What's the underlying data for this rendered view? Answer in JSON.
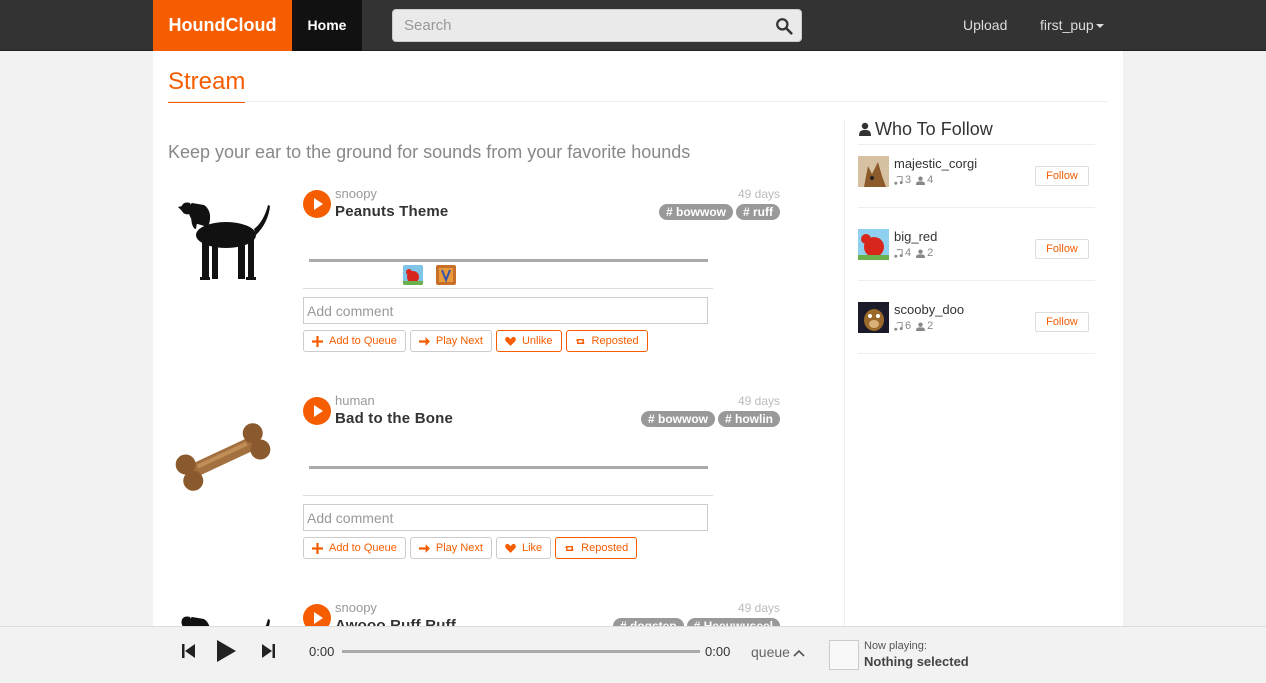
{
  "navbar": {
    "brand": "HoundCloud",
    "home": "Home",
    "search_placeholder": "Search",
    "upload": "Upload",
    "user": "first_pup"
  },
  "page": {
    "title": "Stream",
    "tagline": "Keep your ear to the ground for sounds from your favorite hounds"
  },
  "tracks": [
    {
      "artist": "snoopy",
      "title": "Peanuts Theme",
      "age": "49 days",
      "tags": [
        "# bowwow",
        "# ruff"
      ],
      "comment_placeholder": "Add comment",
      "actions": [
        "Add to Queue",
        "Play Next",
        "Unlike",
        "Reposted"
      ]
    },
    {
      "artist": "human",
      "title": "Bad to the Bone",
      "age": "49 days",
      "tags": [
        "# bowwow",
        "# howlin"
      ],
      "comment_placeholder": "Add comment",
      "actions": [
        "Add to Queue",
        "Play Next",
        "Like",
        "Reposted"
      ]
    },
    {
      "artist": "snoopy",
      "title": "Awooo Ruff Ruff",
      "age": "49 days",
      "tags": [
        "# dogstep",
        "# Heeuwuseel"
      ]
    }
  ],
  "sidebar": {
    "heading": "Who To Follow",
    "follow_label": "Follow",
    "users": [
      {
        "name": "majestic_corgi",
        "tracks": "3",
        "followers": "4"
      },
      {
        "name": "big_red",
        "tracks": "4",
        "followers": "2"
      },
      {
        "name": "scooby_doo",
        "tracks": "6",
        "followers": "2"
      }
    ]
  },
  "player": {
    "current_time": "0:00",
    "duration": "0:00",
    "queue_label": "queue",
    "now_playing_label": "Now playing:",
    "now_playing_value": "Nothing selected"
  },
  "colors": {
    "accent": "#f55d00",
    "navbar": "#333333",
    "tag": "#999999"
  }
}
